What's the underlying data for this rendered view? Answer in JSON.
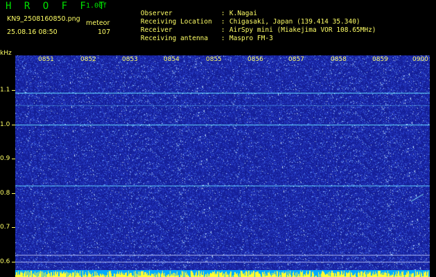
{
  "header": {
    "brand": "H R O F F T",
    "version": "1.00f",
    "filename": "KN9_2508160850.png",
    "datetime": "25.08.16 08:50",
    "meteor_label": "meteor",
    "meteor_count": "107",
    "info": [
      {
        "label": "Observer",
        "sep": ":",
        "value": "K.Nagai"
      },
      {
        "label": "Receiving Location",
        "sep": ":",
        "value": "Chigasaki, Japan (139.414 35.340)"
      },
      {
        "label": "Receiver",
        "sep": ":",
        "value": "AirSpy mini (Miakejima VOR 108.65MHz)"
      },
      {
        "label": "Receiving antenna",
        "sep": ":",
        "value": "Maspro FM-3"
      }
    ]
  },
  "axes": {
    "y_unit_label": "kHz",
    "y_ticks": [
      "1.1",
      "1.0",
      "0.9",
      "0.8",
      "0.7",
      "0.6"
    ],
    "x_ticks": [
      "0851",
      "0852",
      "0853",
      "0854",
      "0855",
      "0856",
      "0857",
      "0858",
      "0859",
      "0900"
    ]
  },
  "colors": {
    "background": "#1a2a9c",
    "text": "#ffff66",
    "brand": "#00e000",
    "signal": "#66ddff"
  }
}
